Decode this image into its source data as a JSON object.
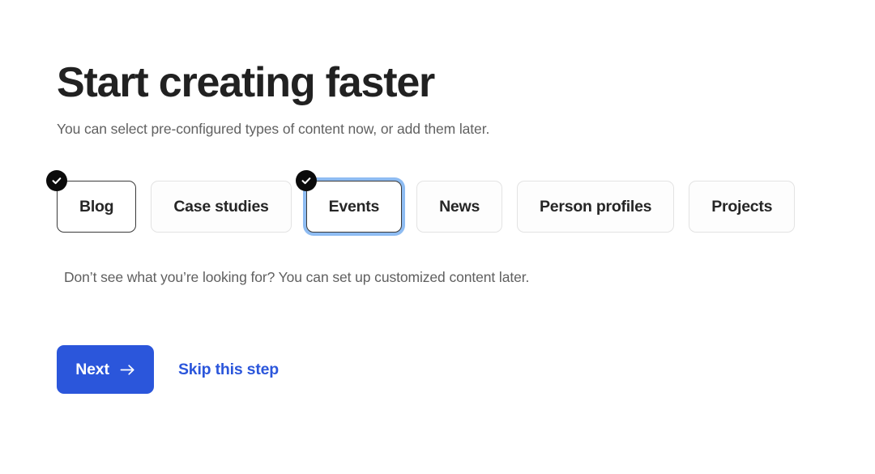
{
  "heading": "Start creating faster",
  "subtitle": "You can select pre-configured types of content now, or add them later.",
  "chips": [
    {
      "label": "Blog",
      "selected": true,
      "focused": false,
      "badge_icon": "check-icon"
    },
    {
      "label": "Case studies",
      "selected": false,
      "focused": false,
      "badge_icon": ""
    },
    {
      "label": "Events",
      "selected": true,
      "focused": true,
      "badge_icon": "check-icon"
    },
    {
      "label": "News",
      "selected": false,
      "focused": false,
      "badge_icon": ""
    },
    {
      "label": "Person profiles",
      "selected": false,
      "focused": false,
      "badge_icon": ""
    },
    {
      "label": "Projects",
      "selected": false,
      "focused": false,
      "badge_icon": ""
    }
  ],
  "helper_text": "Don’t see what you’re looking for? You can set up customized content later.",
  "actions": {
    "next_label": "Next",
    "next_icon": "arrow-right-icon",
    "skip_label": "Skip this step"
  },
  "colors": {
    "accent_blue": "#2b56db",
    "focus_ring": "#8ebcf2",
    "badge_black": "#0b0b0b",
    "heading": "#212121",
    "muted_text": "#5f5f5f",
    "chip_border": "#e3e3e3",
    "chip_border_selected": "#3a3a3a",
    "background": "#ffffff"
  }
}
